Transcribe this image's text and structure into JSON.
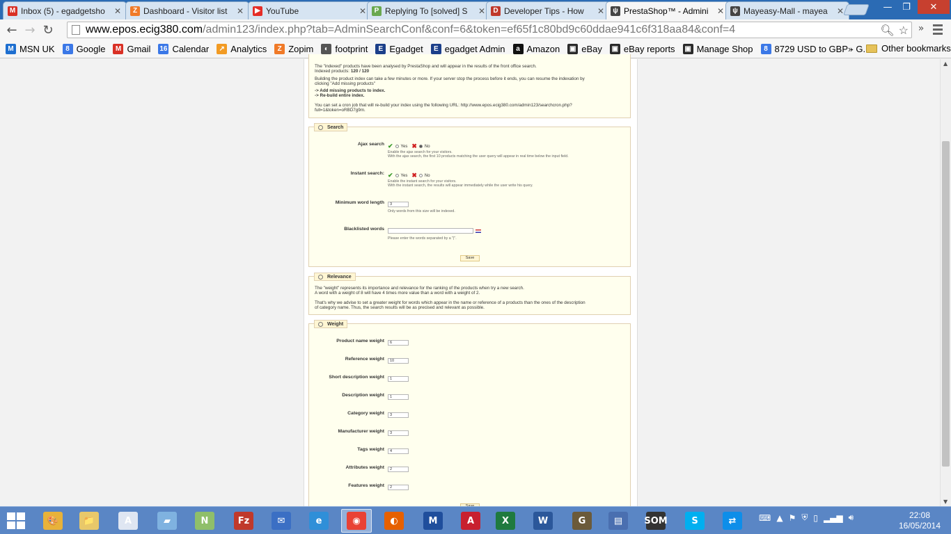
{
  "browser": {
    "tabs": [
      {
        "title": "Inbox (5) - egadgetsho",
        "icon": "gmail-icon",
        "color": "#d93025",
        "glyph": "M"
      },
      {
        "title": "Dashboard - Visitor list",
        "icon": "zopim-icon",
        "color": "#f07a28",
        "glyph": "Z"
      },
      {
        "title": "YouTube",
        "icon": "youtube-icon",
        "color": "#e52d27",
        "glyph": "▶"
      },
      {
        "title": "Replying To [solved] S",
        "icon": "prestashop-forum-icon",
        "color": "#6aa84f",
        "glyph": "P"
      },
      {
        "title": "Developer Tips - How",
        "icon": "devtips-icon",
        "color": "#c0392b",
        "glyph": "D"
      },
      {
        "title": "PrestaShop™ - Admini",
        "icon": "prestashop-icon",
        "color": "#444444",
        "glyph": "ψ"
      },
      {
        "title": "Mayeasy-Mall - mayea",
        "icon": "prestashop-icon",
        "color": "#444444",
        "glyph": "ψ"
      }
    ],
    "active_tab": 5,
    "window_controls": {
      "minimize": "—",
      "maximize": "❐",
      "close": "✕"
    },
    "url_host": "www.epos.ecig380.com",
    "url_path": "/admin123/index.php?tab=AdminSearchConf&conf=6&token=ef65f1c80bd9c60ddae941c6f318aa84&conf=4",
    "bookmarks": [
      {
        "label": "MSN UK",
        "icon": "msn-icon",
        "color": "#1e6fd0",
        "glyph": "M"
      },
      {
        "label": "Google",
        "icon": "google-icon",
        "color": "#3b78e7",
        "glyph": "8"
      },
      {
        "label": "Gmail",
        "icon": "gmail-icon",
        "color": "#d93025",
        "glyph": "M"
      },
      {
        "label": "Calendar",
        "icon": "calendar-icon",
        "color": "#3b78e7",
        "glyph": "16"
      },
      {
        "label": "Analytics",
        "icon": "analytics-icon",
        "color": "#f29b24",
        "glyph": "↗"
      },
      {
        "label": "Zopim",
        "icon": "zopim-icon",
        "color": "#f07a28",
        "glyph": "Z"
      },
      {
        "label": "footprint",
        "icon": "footprint-icon",
        "color": "#555555",
        "glyph": "◐"
      },
      {
        "label": "Egadget",
        "icon": "egadget-icon",
        "color": "#1c3f8a",
        "glyph": "E"
      },
      {
        "label": "egadget Admin",
        "icon": "egadget-icon",
        "color": "#1c3f8a",
        "glyph": "E"
      },
      {
        "label": "Amazon",
        "icon": "amazon-icon",
        "color": "#111111",
        "glyph": "a"
      },
      {
        "label": "eBay",
        "icon": "ebay-icon",
        "color": "#2a2a2a",
        "glyph": "▣"
      },
      {
        "label": "eBay reports",
        "icon": "ebay-icon",
        "color": "#2a2a2a",
        "glyph": "▣"
      },
      {
        "label": "Manage Shop",
        "icon": "shop-icon",
        "color": "#2a2a2a",
        "glyph": "▣"
      },
      {
        "label": "8729 USD to GBP - G...",
        "icon": "google-icon",
        "color": "#3b78e7",
        "glyph": "8"
      }
    ],
    "bookmarks_more": "»",
    "other_bookmarks": "Other bookmarks"
  },
  "page": {
    "indexation": {
      "line1": "The \"indexed\" products have been analysed by PrestaShop and will appear in the results of the front office search.",
      "line2_label": "Indexed products: ",
      "line2_value": "120 / 120",
      "line3": "Building the product index can take a few minutes or more. If your server stop the process before it ends, you can resume the indexation by",
      "line4": "clicking \"Add missing products\"",
      "link1": "-> Add missing products to index.",
      "link2": "-> Re-build entire index.",
      "cron1": "You can set a cron job that will re-build your index using the following URL: http://www.epos.ecig380.com/admin123/searchcron.php?",
      "cron2": "full=1&token=oRBD7g9m."
    },
    "search": {
      "legend": "Search",
      "ajax_label": "Ajax search",
      "ajax_yes": "Yes",
      "ajax_no": "No",
      "ajax_selected": "No",
      "ajax_hint1": "Enable the ajax search for your visitors.",
      "ajax_hint2": "With the ajax search, the first 10 products matching the user query will appear in real time below the input field.",
      "instant_label": "Instant search:",
      "instant_yes": "Yes",
      "instant_no": "No",
      "instant_selected": "No",
      "instant_hint1": "Enable the instant search for your visitors.",
      "instant_hint2": "With the instant search, the results will appear immediately while the user write his query.",
      "minword_label": "Minimum word length",
      "minword_value": "3",
      "minword_hint": "Only words from this size will be indexed.",
      "blacklist_label": "Blacklisted words",
      "blacklist_value": "",
      "blacklist_hint": "Please enter the words separated by a \"|\".",
      "save": "Save"
    },
    "relevance": {
      "legend": "Relevance",
      "p1": "The \"weight\" represents its importance and relevance for the ranking of the products when try a new search.",
      "p2": "A word with a weight of 8 will have 4 times more value than a word with a weight of 2.",
      "p3": "That's why we advise to set a greater weight for words which appear in the name or reference of a products than the ones of the description",
      "p4": "of category name. Thus, the search results will be as precised and relevant as possible."
    },
    "weight": {
      "legend": "Weight",
      "fields": [
        {
          "label": "Product name weight",
          "value": "6"
        },
        {
          "label": "Reference weight",
          "value": "10"
        },
        {
          "label": "Short description weight",
          "value": "1"
        },
        {
          "label": "Description weight",
          "value": "1"
        },
        {
          "label": "Category weight",
          "value": "3"
        },
        {
          "label": "Manufacturer weight",
          "value": "3"
        },
        {
          "label": "Tags weight",
          "value": "4"
        },
        {
          "label": "Attributes weight",
          "value": "2"
        },
        {
          "label": "Features weight",
          "value": "2"
        }
      ],
      "save": "Save"
    }
  },
  "taskbar": {
    "apps": [
      {
        "name": "paint-icon",
        "color": "#e8b23a",
        "glyph": "🎨"
      },
      {
        "name": "explorer-icon",
        "color": "#e8c86a",
        "glyph": "📁"
      },
      {
        "name": "word-doc-icon",
        "color": "#dfe6f2",
        "glyph": "A"
      },
      {
        "name": "notes-icon",
        "color": "#7fb2e0",
        "glyph": "▰"
      },
      {
        "name": "notepad-plus-icon",
        "color": "#8fbf6a",
        "glyph": "N"
      },
      {
        "name": "filezilla-icon",
        "color": "#c0392b",
        "glyph": "Fz"
      },
      {
        "name": "thunderbird-icon",
        "color": "#3b6fc4",
        "glyph": "✉"
      },
      {
        "name": "internet-explorer-icon",
        "color": "#2f8fd8",
        "glyph": "e"
      },
      {
        "name": "chrome-icon",
        "color": "#e94235",
        "glyph": "◉"
      },
      {
        "name": "firefox-icon",
        "color": "#e66000",
        "glyph": "◐"
      },
      {
        "name": "mcafee-icon",
        "color": "#1f4e9c",
        "glyph": "M"
      },
      {
        "name": "acrobat-icon",
        "color": "#c8202f",
        "glyph": "A"
      },
      {
        "name": "excel-icon",
        "color": "#1f7a3f",
        "glyph": "X"
      },
      {
        "name": "word-icon",
        "color": "#2b579a",
        "glyph": "W"
      },
      {
        "name": "gimp-icon",
        "color": "#6b5a3a",
        "glyph": "G"
      },
      {
        "name": "monitor-icon",
        "color": "#4a6fb0",
        "glyph": "▤"
      },
      {
        "name": "som-icon",
        "color": "#333333",
        "glyph": "SOM"
      },
      {
        "name": "skype-icon",
        "color": "#00aff0",
        "glyph": "S"
      },
      {
        "name": "teamviewer-icon",
        "color": "#0e8ee9",
        "glyph": "⇄"
      }
    ],
    "active_app": 8,
    "time": "22:08",
    "date": "16/05/2014"
  }
}
